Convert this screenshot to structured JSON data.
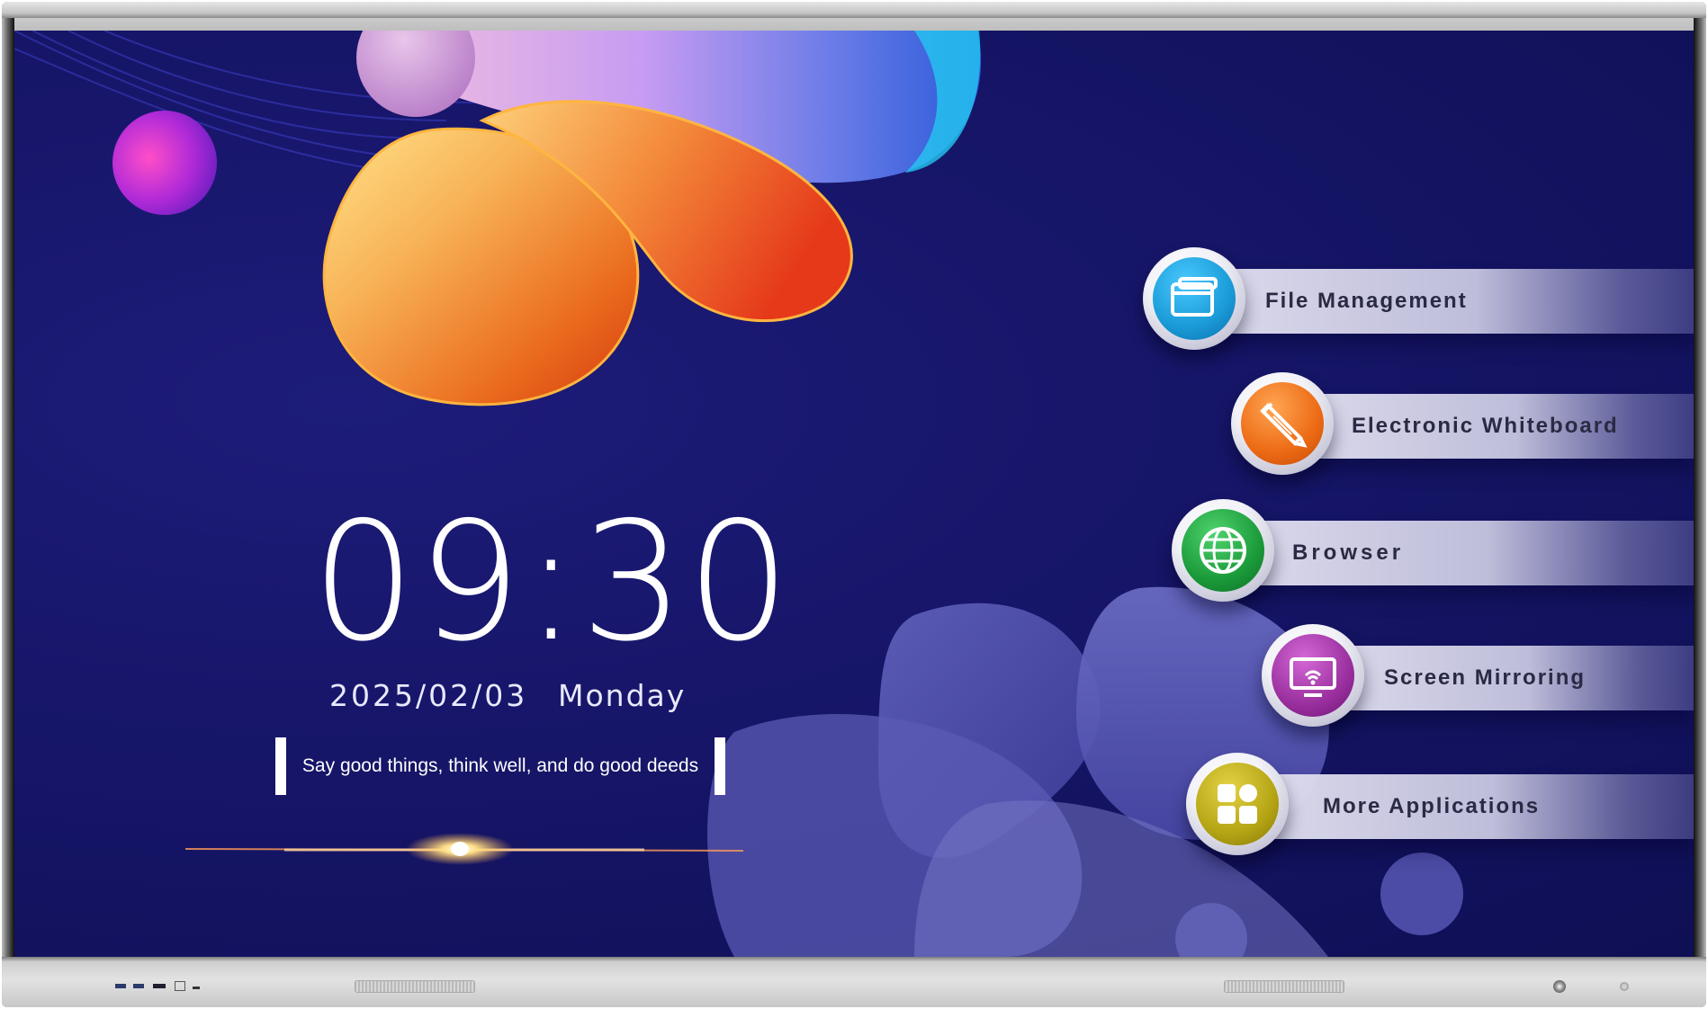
{
  "clock": {
    "time": "09:30",
    "date": "2025/02/03",
    "weekday": "Monday"
  },
  "quote": "Say good things, think well, and do good deeds",
  "apps": [
    {
      "label": "File Management",
      "icon": "folder-window-icon",
      "color": "#1a9ad6"
    },
    {
      "label": "Electronic Whiteboard",
      "icon": "pencil-icon",
      "color": "#ec6a14"
    },
    {
      "label": "Browser",
      "icon": "globe-icon",
      "color": "#1b9a3a"
    },
    {
      "label": "Screen Mirroring",
      "icon": "cast-screen-icon",
      "color": "#9a2f9e"
    },
    {
      "label": "More Applications",
      "icon": "app-grid-icon",
      "color": "#b5a414"
    }
  ],
  "bezel": {
    "frame_color": "#c8c8c8",
    "screen_color": "#17166a"
  }
}
